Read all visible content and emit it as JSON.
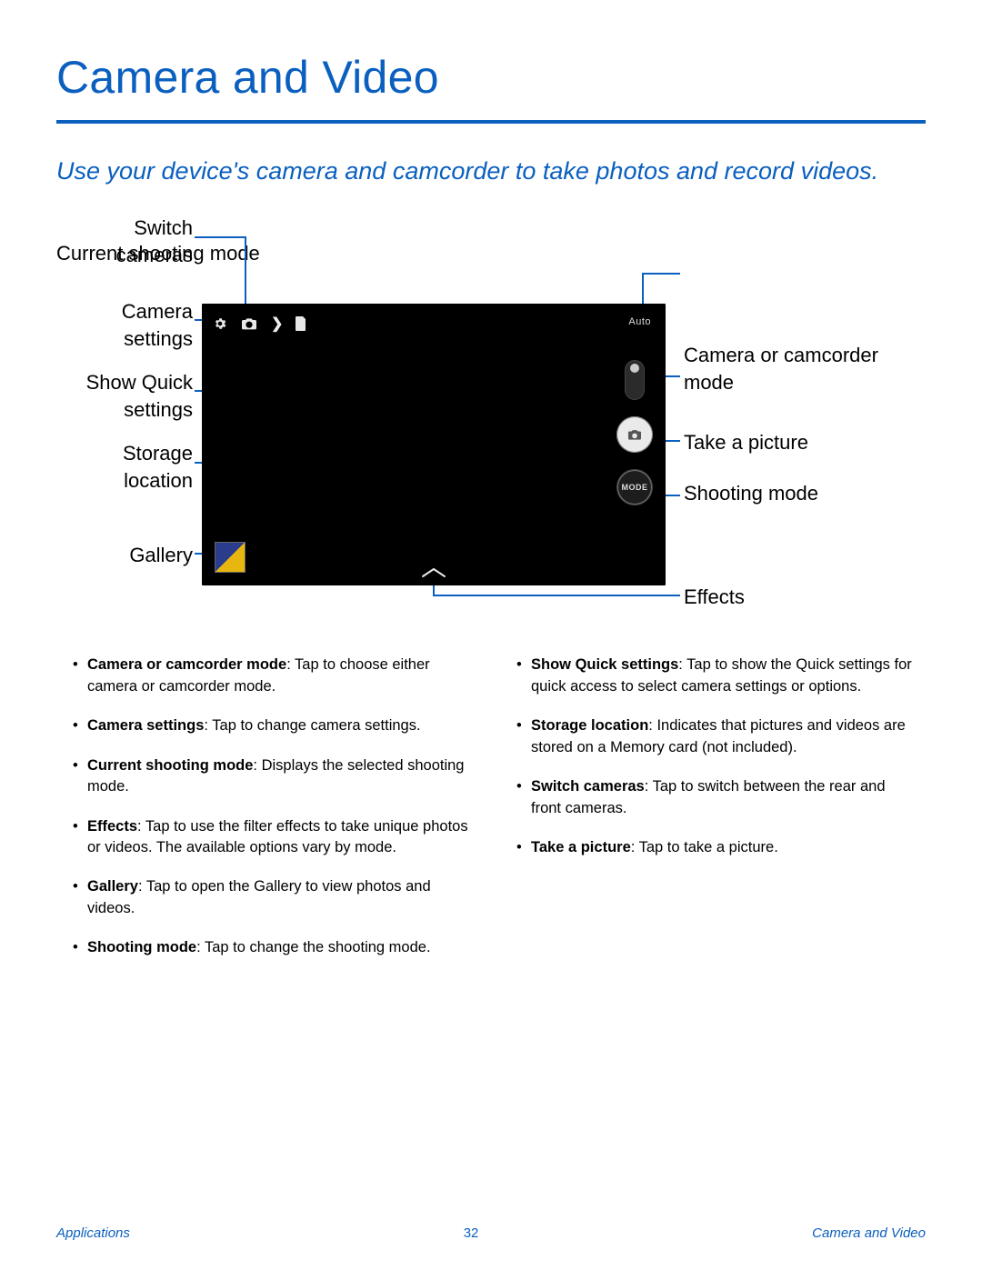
{
  "title": "Camera and Video",
  "lead": "Use your device's camera and camcorder to take photos and record videos.",
  "callouts": {
    "switch_cameras": "Switch cameras",
    "camera_settings": "Camera settings",
    "show_quick_settings": "Show Quick settings",
    "storage_location": "Storage location",
    "gallery": "Gallery",
    "current_shooting_mode": "Current shooting mode",
    "camera_or_camcorder_mode": "Camera or camcorder mode",
    "take_a_picture": "Take a picture",
    "shooting_mode": "Shooting mode",
    "effects": "Effects"
  },
  "screenshot": {
    "auto_label": "Auto",
    "mode_label": "MODE"
  },
  "bullets_left": [
    {
      "term": "Camera or camcorder mode",
      "desc": ": Tap to choose either camera or camcorder mode."
    },
    {
      "term": "Camera settings",
      "desc": ": Tap to change camera settings."
    },
    {
      "term": "Current shooting mode",
      "desc": ": Displays the selected shooting mode."
    },
    {
      "term": "Effects",
      "desc": ": Tap to use the filter effects to take unique photos or videos. The available options vary by mode."
    },
    {
      "term": "Gallery",
      "desc": ": Tap to open the Gallery to view photos and videos."
    },
    {
      "term": "Shooting mode",
      "desc": ": Tap to change the shooting mode."
    }
  ],
  "bullets_right": [
    {
      "term": "Show Quick settings",
      "desc": ": Tap to show the Quick settings for quick access to select camera settings or options."
    },
    {
      "term": "Storage location",
      "desc": ": Indicates that pictures and videos are stored on a Memory card (not included)."
    },
    {
      "term": "Switch cameras",
      "desc": ": Tap to switch between the rear and front cameras."
    },
    {
      "term": "Take a picture",
      "desc": ": Tap to take a picture."
    }
  ],
  "footer": {
    "left": "Applications",
    "page": "32",
    "right": "Camera and Video"
  }
}
